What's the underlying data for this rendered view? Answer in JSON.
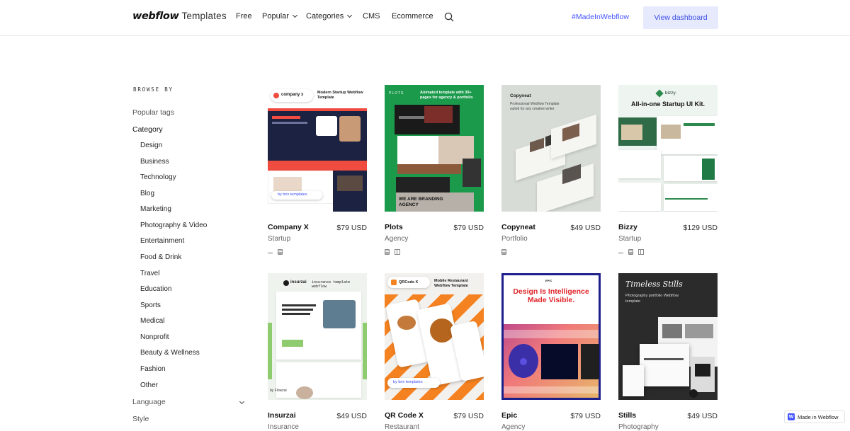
{
  "header": {
    "logo_mark": "webflow",
    "logo_suffix": "Templates",
    "nav": [
      {
        "label": "Free"
      },
      {
        "label": "Popular",
        "dropdown": true
      },
      {
        "label": "Categories",
        "dropdown": true
      },
      {
        "label": "CMS"
      },
      {
        "label": "Ecommerce"
      }
    ],
    "search_icon": "search-icon",
    "hashtag": "#MadeInWebflow",
    "dashboard_button": "View dashboard",
    "accent_color": "#4353ff"
  },
  "sidebar": {
    "browse_by": "BROWSE BY",
    "popular_tags": "Popular tags",
    "category": "Category",
    "categories": [
      "Design",
      "Business",
      "Technology",
      "Blog",
      "Marketing",
      "Photography & Video",
      "Entertainment",
      "Food & Drink",
      "Travel",
      "Education",
      "Sports",
      "Medical",
      "Nonprofit",
      "Beauty & Wellness",
      "Fashion",
      "Other"
    ],
    "language": "Language",
    "style": "Style"
  },
  "templates": [
    {
      "name": "Company X",
      "price": "$79 USD",
      "category": "Startup",
      "features": [
        "cart-icon",
        "cms-icon"
      ],
      "thumb": {
        "logo": "company x",
        "headline": "Modern Startup Webflow Template",
        "badge": "by brix templates"
      }
    },
    {
      "name": "Plots",
      "price": "$79 USD",
      "category": "Agency",
      "features": [
        "cms-icon",
        "layout-icon"
      ],
      "thumb": {
        "logo": "PLOTS",
        "headline": "Animated template with 30+ pages for agency & portfolio",
        "tagline": "WE ARE BRANDING AGENCY"
      }
    },
    {
      "name": "Copyneat",
      "price": "$49 USD",
      "category": "Portfolio",
      "features": [
        "cms-icon"
      ],
      "thumb": {
        "logo": "Copyneat",
        "headline": "Professional Webflow Template suited for any creative writer"
      }
    },
    {
      "name": "Bizzy",
      "price": "$129 USD",
      "category": "Startup",
      "features": [
        "cart-icon",
        "cms-icon",
        "layout-icon"
      ],
      "thumb": {
        "logo": "bizzy.",
        "headline": "All-in-one Startup UI Kit."
      }
    },
    {
      "name": "Insurzai",
      "price": "$49 USD",
      "category": "Insurance",
      "features": [],
      "thumb": {
        "logo": "insurzai",
        "headline": "insurance template webflow",
        "badge": "by Flowzai"
      }
    },
    {
      "name": "QR Code X",
      "price": "$79 USD",
      "category": "Restaurant",
      "features": [],
      "thumb": {
        "logo": "QRCode X",
        "headline": "Mobile Restaurant Webflow Template",
        "badge": "by brix templates"
      }
    },
    {
      "name": "Epic",
      "price": "$79 USD",
      "category": "Agency",
      "features": [],
      "thumb": {
        "logo": "EPIC",
        "headline": "Design Is Intelligence Made Visible."
      }
    },
    {
      "name": "Stills",
      "price": "$49 USD",
      "category": "Photography",
      "features": [],
      "thumb": {
        "logo": "Timeless Stills",
        "headline": "Photography portfolio Webflow template"
      }
    }
  ],
  "made_in_webflow": "Made in Webflow"
}
